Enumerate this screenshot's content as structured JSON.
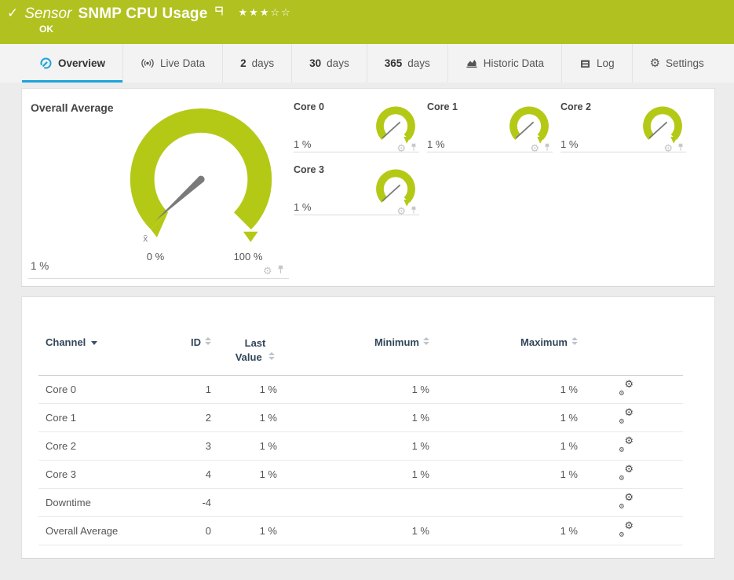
{
  "header": {
    "check_icon": "✓",
    "kind_label": "Sensor",
    "title": "SNMP CPU Usage",
    "rating": "★★★☆☆",
    "status": "OK"
  },
  "tabs": {
    "overview": "Overview",
    "live_data": "Live Data",
    "d2_num": "2",
    "d2_label": "days",
    "d30_num": "30",
    "d30_label": "days",
    "d365_num": "365",
    "d365_label": "days",
    "historic": "Historic Data",
    "log": "Log",
    "settings": "Settings"
  },
  "gauges": {
    "overall": {
      "title": "Overall Average",
      "value": "1 %",
      "value_percent": 1,
      "scale_min": "0 %",
      "scale_max": "100 %",
      "avg_marker": "x̄"
    },
    "cores": [
      {
        "title": "Core 0",
        "value": "1 %",
        "value_percent": 1
      },
      {
        "title": "Core 1",
        "value": "1 %",
        "value_percent": 1
      },
      {
        "title": "Core 2",
        "value": "1 %",
        "value_percent": 1
      },
      {
        "title": "Core 3",
        "value": "1 %",
        "value_percent": 1
      }
    ]
  },
  "table": {
    "columns": {
      "channel": "Channel",
      "id": "ID",
      "last_value": "Last Value",
      "minimum": "Minimum",
      "maximum": "Maximum"
    },
    "rows": [
      {
        "channel": "Core 0",
        "id": "1",
        "last_value": "1 %",
        "minimum": "1 %",
        "maximum": "1 %"
      },
      {
        "channel": "Core 1",
        "id": "2",
        "last_value": "1 %",
        "minimum": "1 %",
        "maximum": "1 %"
      },
      {
        "channel": "Core 2",
        "id": "3",
        "last_value": "1 %",
        "minimum": "1 %",
        "maximum": "1 %"
      },
      {
        "channel": "Core 3",
        "id": "4",
        "last_value": "1 %",
        "minimum": "1 %",
        "maximum": "1 %"
      },
      {
        "channel": "Downtime",
        "id": "-4",
        "last_value": "",
        "minimum": "",
        "maximum": ""
      },
      {
        "channel": "Overall Average",
        "id": "0",
        "last_value": "1 %",
        "minimum": "1 %",
        "maximum": "1 %"
      }
    ]
  },
  "colors": {
    "header_green": "#b1c120",
    "gauge_green": "#b4c916",
    "accent_blue": "#1ca3dc",
    "table_header_navy": "#32465a"
  }
}
